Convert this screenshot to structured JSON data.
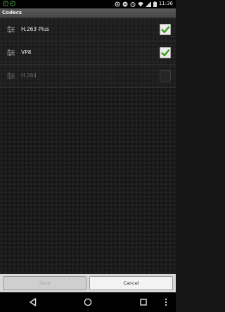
{
  "status_bar": {
    "notifications": [
      "check-circle-icon",
      "check-circle-icon"
    ],
    "icons": [
      "data-saver-icon",
      "do-not-disturb-icon",
      "alarm-icon",
      "wifi-icon",
      "cellular-icon",
      "battery-icon"
    ],
    "time": "11:36"
  },
  "title": "Codecs",
  "codecs": [
    {
      "name": "H.263 Plus",
      "checked": true,
      "enabled": true
    },
    {
      "name": "VP8",
      "checked": true,
      "enabled": true
    },
    {
      "name": "H.264",
      "checked": false,
      "enabled": false
    }
  ],
  "buttons": {
    "save": "Save",
    "cancel": "Cancel"
  },
  "colors": {
    "check": "#3a9a1e",
    "title_bar": "#515151",
    "background": "#1b1b1b"
  }
}
